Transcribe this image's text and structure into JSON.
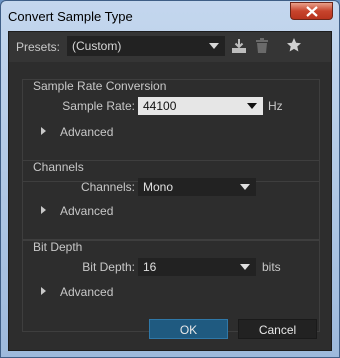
{
  "window": {
    "title": "Convert Sample Type"
  },
  "toolbar": {
    "presets_label": "Presets:",
    "presets_value": "(Custom)",
    "icons": [
      "save-preset-icon",
      "trash-icon",
      "star-icon"
    ]
  },
  "sample_rate": {
    "title": "Sample Rate Conversion",
    "label": "Sample Rate:",
    "value": "44100",
    "unit": "Hz",
    "advanced": "Advanced"
  },
  "channels": {
    "title": "Channels",
    "label": "Channels:",
    "value": "Mono",
    "advanced": "Advanced"
  },
  "bit_depth": {
    "title": "Bit Depth",
    "label": "Bit Depth:",
    "value": "16",
    "unit": "bits",
    "advanced": "Advanced"
  },
  "buttons": {
    "ok": "OK",
    "cancel": "Cancel"
  },
  "colors": {
    "accent_ok": "#1f5a80",
    "panel": "#2d2d2d",
    "titlebar": "#b4cbe8",
    "close": "#c7442d"
  }
}
